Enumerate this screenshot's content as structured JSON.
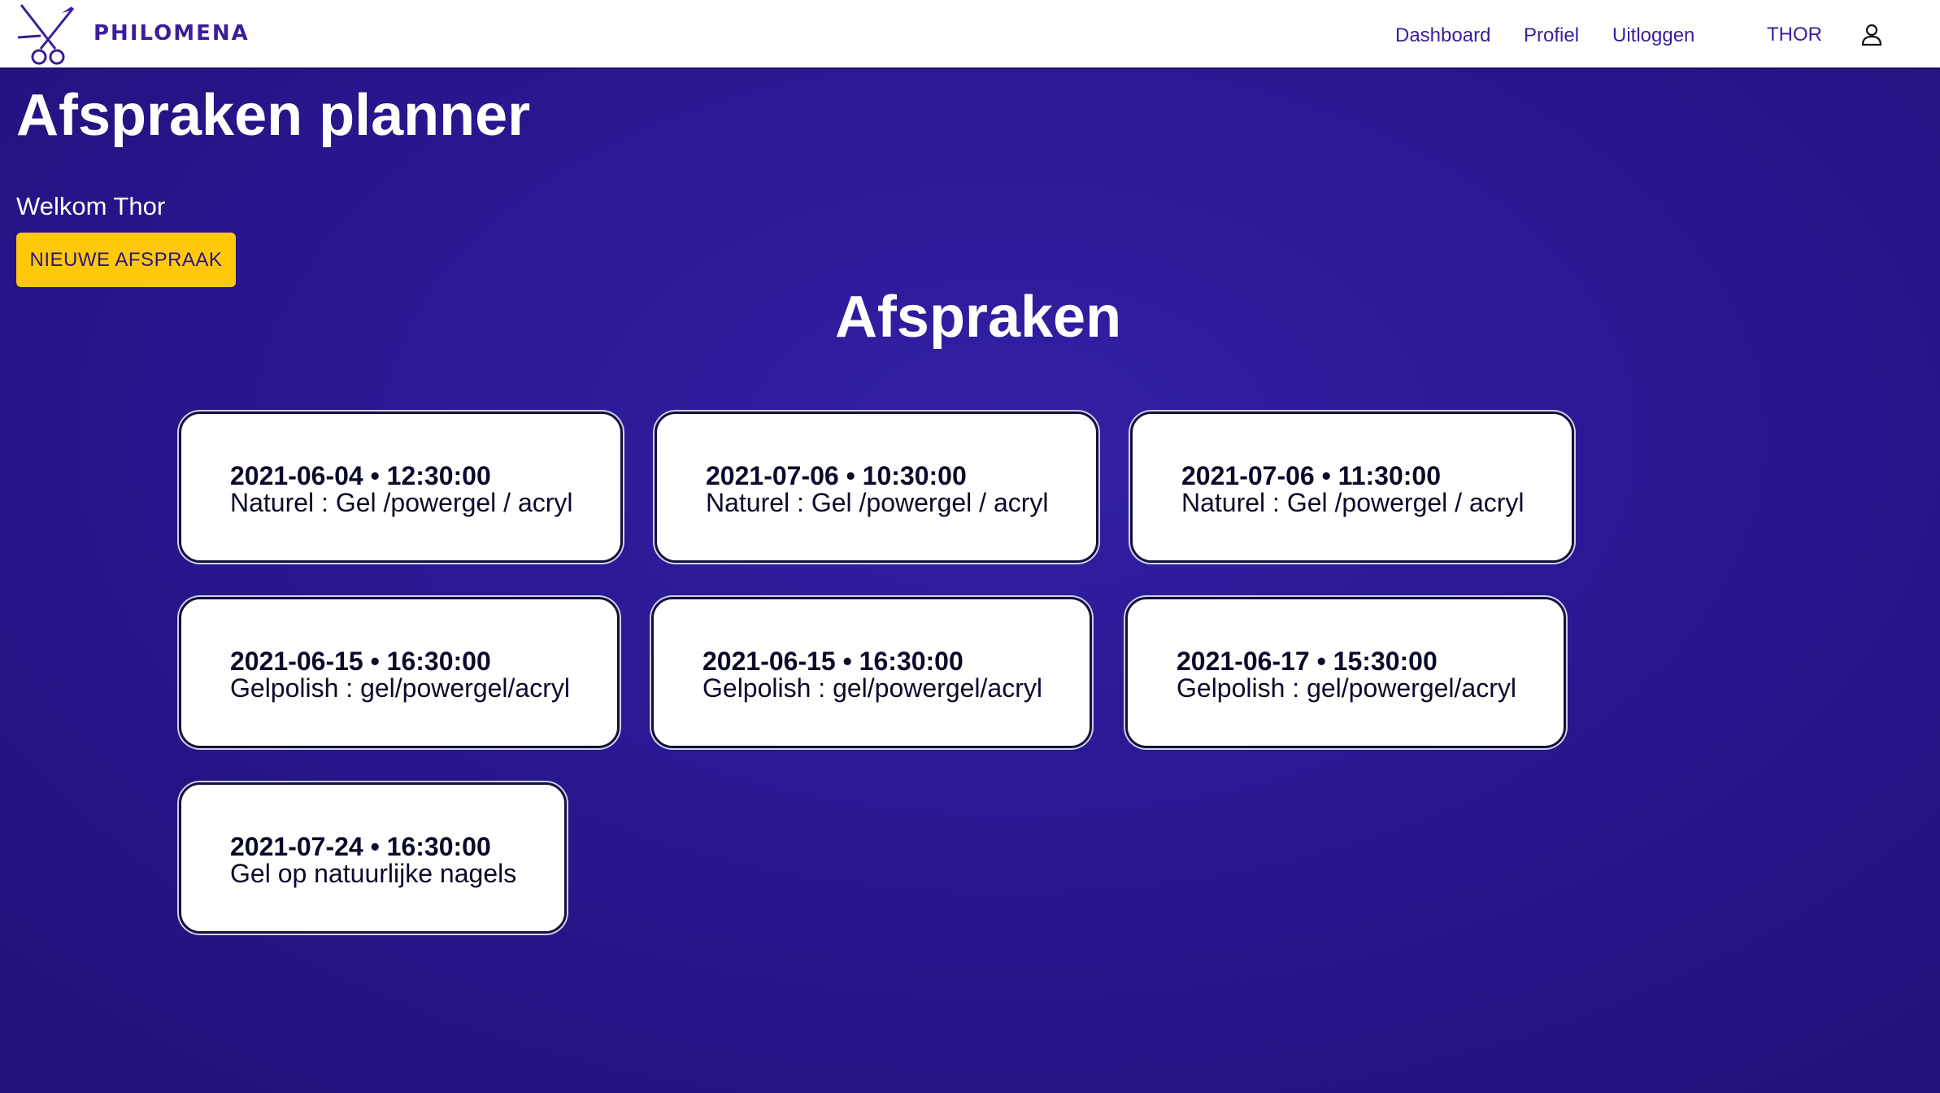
{
  "header": {
    "brand": "PHILOMENA",
    "nav": {
      "dashboard": "Dashboard",
      "profile": "Profiel",
      "logout": "Uitloggen"
    },
    "username": "THOR"
  },
  "main": {
    "title": "Afspraken planner",
    "welcome": "Welkom Thor",
    "new_button": "NIEUWE AFSPRAAK",
    "section_title": "Afspraken"
  },
  "appointments": [
    {
      "datetime": "2021-06-04 • 12:30:00",
      "treatment": "Naturel : Gel /powergel / acryl"
    },
    {
      "datetime": "2021-07-06 • 10:30:00",
      "treatment": "Naturel : Gel /powergel / acryl"
    },
    {
      "datetime": "2021-07-06 • 11:30:00",
      "treatment": "Naturel : Gel /powergel / acryl"
    },
    {
      "datetime": "2021-06-15 • 16:30:00",
      "treatment": "Gelpolish : gel/powergel/acryl"
    },
    {
      "datetime": "2021-06-15 • 16:30:00",
      "treatment": "Gelpolish : gel/powergel/acryl"
    },
    {
      "datetime": "2021-06-17 • 15:30:00",
      "treatment": "Gelpolish : gel/powergel/acryl"
    },
    {
      "datetime": "2021-07-24 • 16:30:00",
      "treatment": "Gel op natuurlijke nagels"
    }
  ],
  "colors": {
    "brand": "#3a1d9b",
    "background": "#2a1894",
    "button": "#ffc90a"
  },
  "icons": {
    "logo": "scissors-icon",
    "user": "user-icon"
  }
}
